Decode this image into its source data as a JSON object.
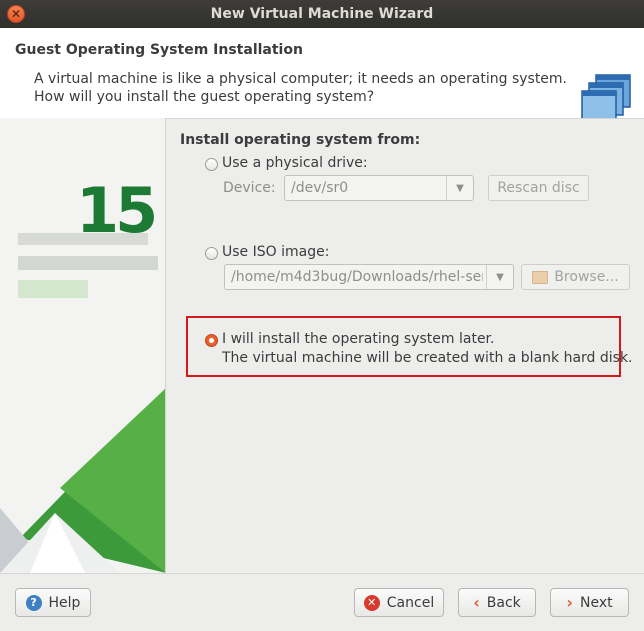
{
  "window": {
    "title": "New Virtual Machine Wizard",
    "close_icon": "close-icon"
  },
  "header": {
    "title": "Guest Operating System Installation",
    "desc_line1": "A virtual machine is like a physical computer; it needs an operating system.",
    "desc_line2": "How will you install the guest operating system?",
    "icon": "stacked-windows-icon"
  },
  "sidebar": {
    "version_number": "15"
  },
  "install": {
    "section_title": "Install operating system from:",
    "physical": {
      "label": "Use a physical drive:",
      "device_label": "Device:",
      "device_value": "/dev/sr0",
      "rescan_label": "Rescan disc",
      "selected": false
    },
    "iso": {
      "label": "Use ISO image:",
      "path_value": "/home/m4d3bug/Downloads/rhel-ser",
      "browse_label": "Browse...",
      "selected": false
    },
    "later": {
      "line1": "I will install the operating system later.",
      "line2": "The virtual machine will be created with a blank hard disk.",
      "selected": true
    }
  },
  "footer": {
    "help_label": "Help",
    "cancel_label": "Cancel",
    "back_label": "Back",
    "next_label": "Next"
  },
  "colors": {
    "accent_radio": "#e9602f",
    "highlight_border": "#d11b1b",
    "brand_green": "#3c9a3a",
    "help_blue": "#3f7fc4",
    "cancel_red": "#d93a2e"
  }
}
